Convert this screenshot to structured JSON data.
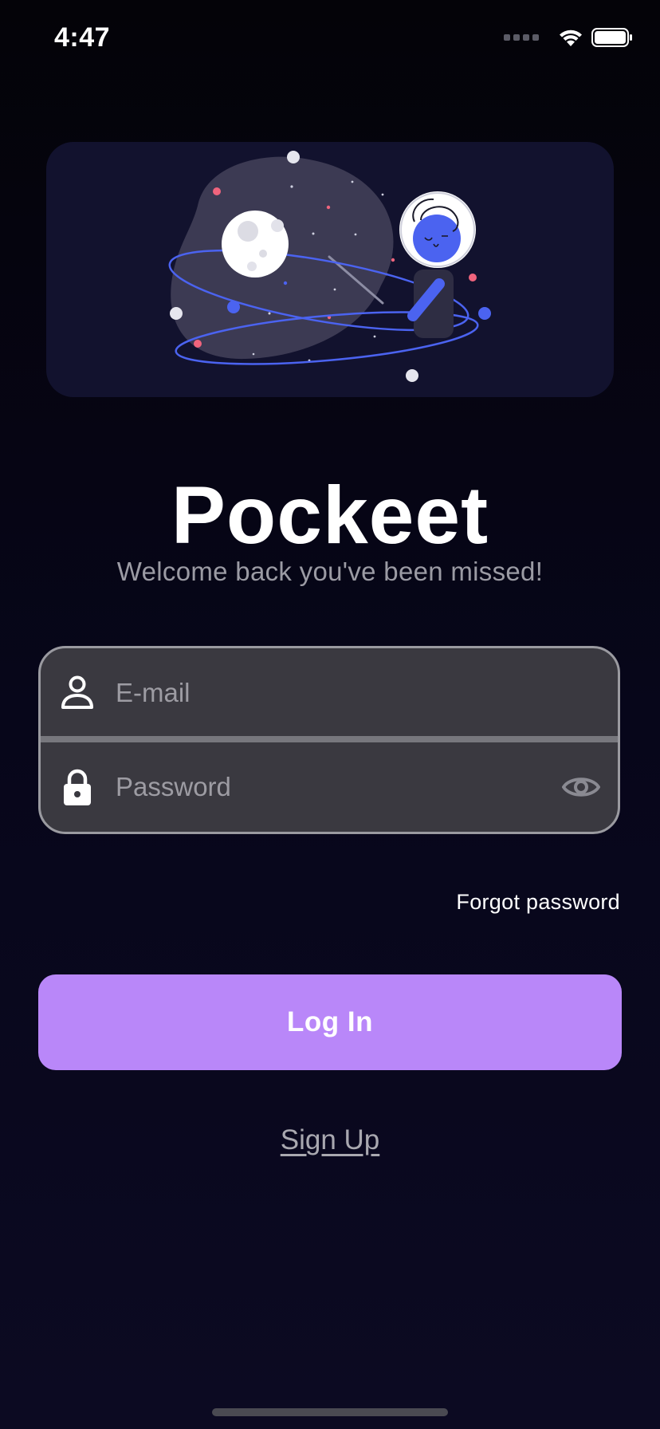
{
  "status_bar": {
    "time": "4:47"
  },
  "app": {
    "name": "Pockeet",
    "tagline": "Welcome back you've been missed!"
  },
  "form": {
    "email_placeholder": "E-mail",
    "email_value": "",
    "password_placeholder": "Password",
    "password_value": "",
    "forgot_label": "Forgot password",
    "login_label": "Log In",
    "signup_label": "Sign Up"
  },
  "icons": {
    "email": "person-icon",
    "password": "lock-icon",
    "visibility": "eye-icon",
    "signal": "signal-icon",
    "wifi": "wifi-icon",
    "battery": "battery-icon"
  },
  "colors": {
    "background": "#07061a",
    "card": "#12122e",
    "accent": "#b987f9",
    "field": "#3a3940",
    "planet_blue": "#4b63f0",
    "star_pink": "#f0647d"
  }
}
